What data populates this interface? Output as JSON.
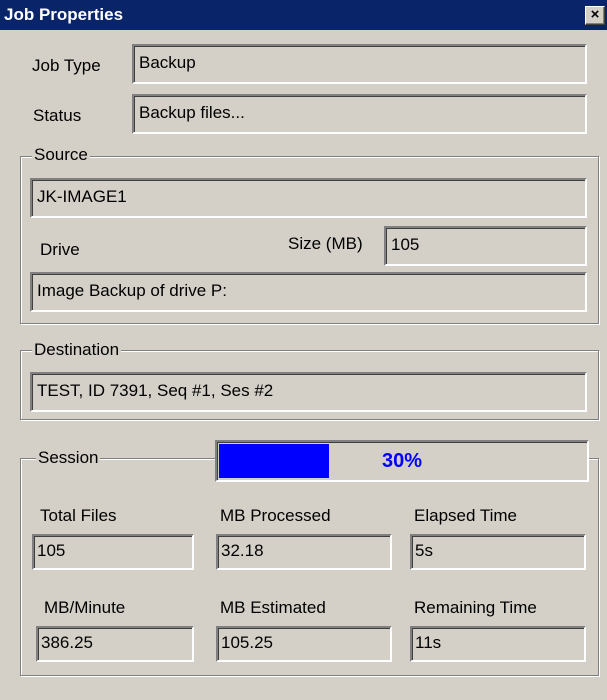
{
  "window": {
    "title": "Job Properties",
    "close_symbol": "×"
  },
  "job": {
    "type_label": "Job Type",
    "type_value": "Backup",
    "status_label": "Status",
    "status_value": "Backup files..."
  },
  "source": {
    "legend": "Source",
    "machine": "JK-IMAGE1",
    "drive_label": "Drive",
    "size_label": "Size (MB)",
    "size_value": "105",
    "description": "Image Backup of drive P:"
  },
  "destination": {
    "legend": "Destination",
    "value": "TEST, ID 7391, Seq #1, Ses #2"
  },
  "session": {
    "legend": "Session",
    "progress": {
      "value": 0.3,
      "text": "30%",
      "color": "#0000ff"
    },
    "total_files_label": "Total Files",
    "total_files_value": "105",
    "mb_processed_label": "MB Processed",
    "mb_processed_value": "32.18",
    "elapsed_label": "Elapsed Time",
    "elapsed_value": "5s",
    "mb_minute_label": "MB/Minute",
    "mb_minute_value": "386.25",
    "mb_estimated_label": "MB Estimated",
    "mb_estimated_value": "105.25",
    "remaining_label": "Remaining Time",
    "remaining_value": "11s"
  },
  "colors": {
    "title_bar": "#0a246a",
    "window_bg": "#d4d0c8"
  }
}
